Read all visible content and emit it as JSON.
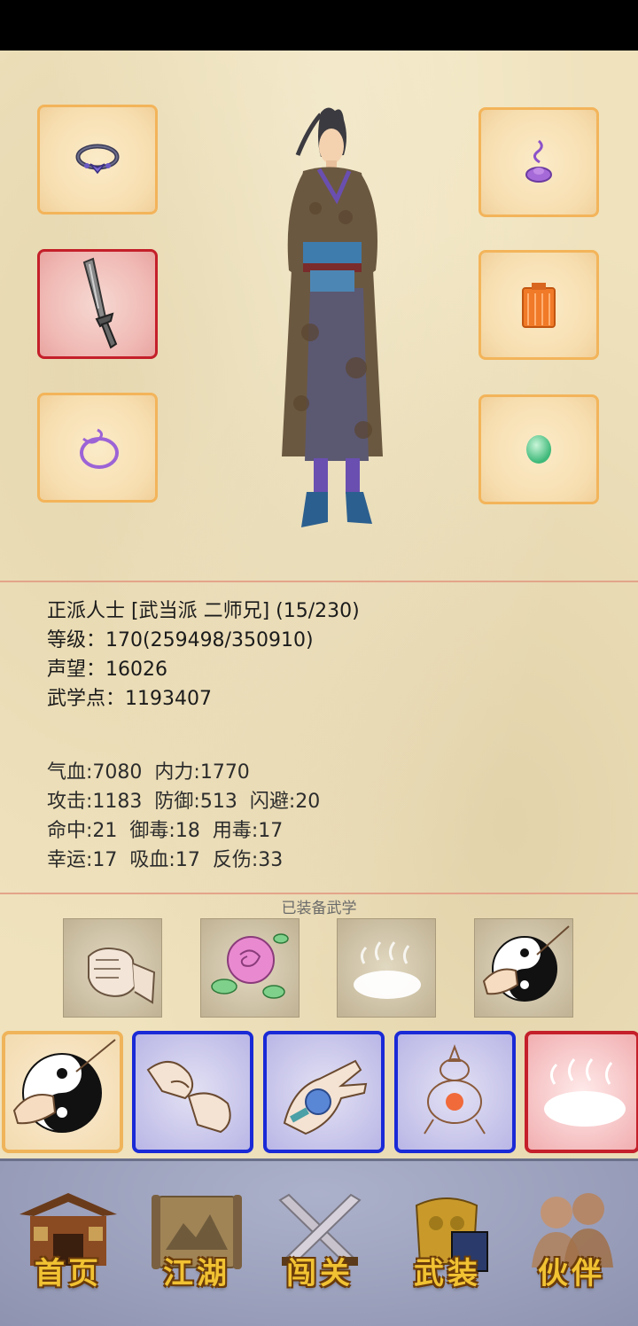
{
  "character": {
    "title_line": "正派人士 [武当派 二师兄] (15/230)",
    "level_line": "等级：170(259498/350910)",
    "reputation_line": "声望：16026",
    "martial_points_line": "武学点：1193407"
  },
  "stats": {
    "row1": {
      "hp": "气血:7080",
      "mp": "内力:1770"
    },
    "row2": {
      "attack": "攻击:1183",
      "defense": "防御:513",
      "dodge": "闪避:20"
    },
    "row3": {
      "hit": "命中:21",
      "poison_res": "御毒:18",
      "poison_use": "用毒:17"
    },
    "row4": {
      "luck": "幸运:17",
      "lifesteal": "吸血:17",
      "reflect": "反伤:33"
    }
  },
  "equipped_section": {
    "title": "已装备武学"
  },
  "nav": {
    "home": "首页",
    "jianghu": "江湖",
    "challenge": "闯关",
    "gear": "武装",
    "partner": "伙伴"
  },
  "colors": {
    "slot_border": "#f3b45a",
    "slot_selected_border": "#c41f2a",
    "skill_blue_border": "#1a2ad6",
    "nav_label": "#f1c232"
  },
  "icons": {
    "equipment_left": [
      "ring-icon",
      "sword-icon",
      "rope-ring-icon"
    ],
    "equipment_right": [
      "incense-icon",
      "armor-icon",
      "jade-icon"
    ],
    "equipped_skills": [
      "fist-icon",
      "rose-icon",
      "mist-icon",
      "yinyang-palm-icon"
    ],
    "skill_cards": [
      "yinyang-palm-icon",
      "linked-fists-icon",
      "palm-flower-icon",
      "gourd-lamp-icon",
      "mist-icon"
    ]
  }
}
